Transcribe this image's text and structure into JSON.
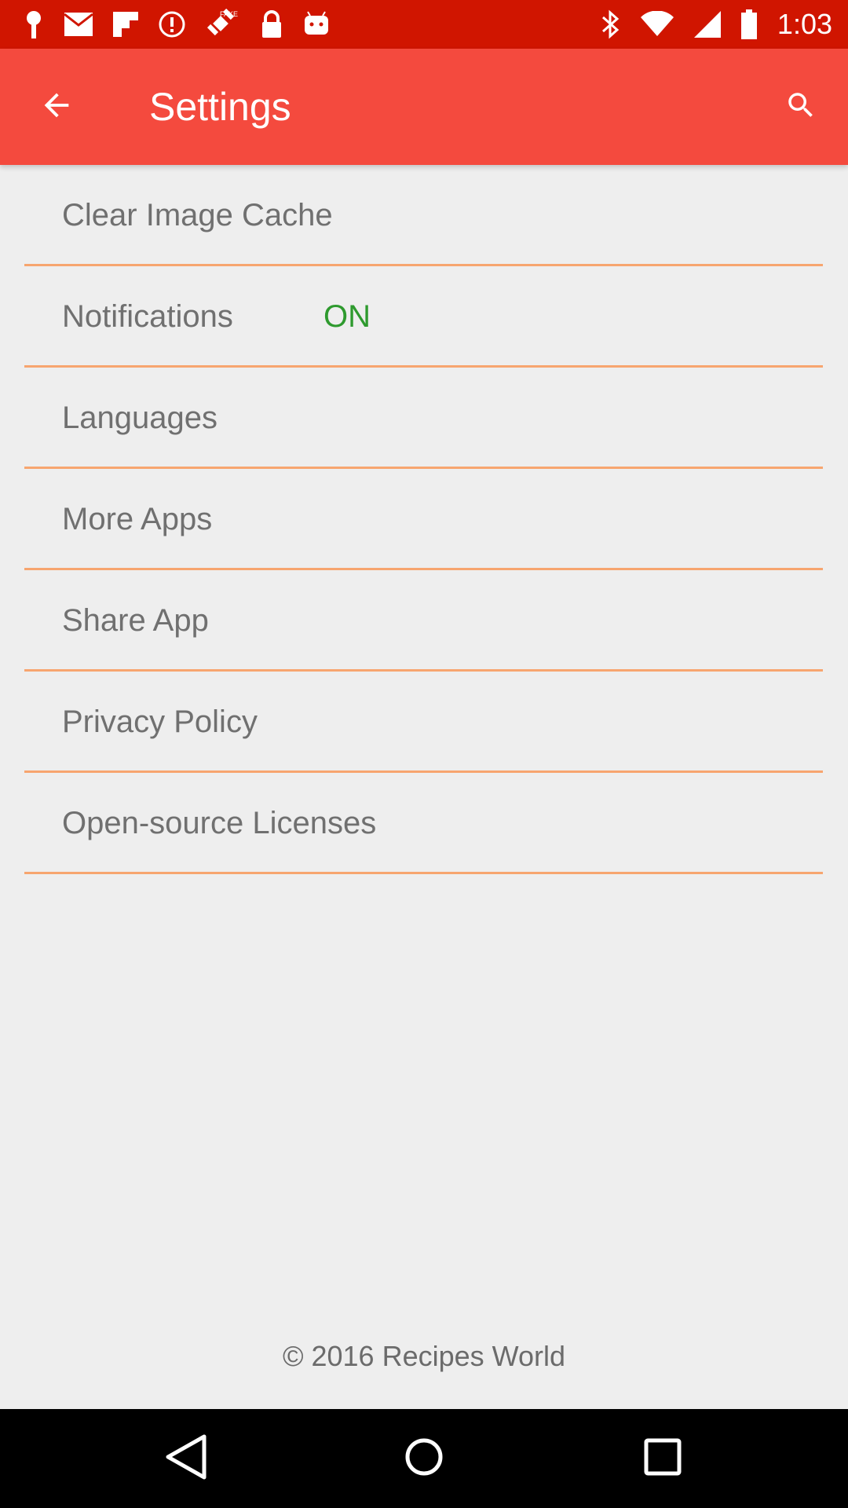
{
  "status_bar": {
    "time": "1:03",
    "left_icons": [
      "pin-icon",
      "mail-icon",
      "flipboard-icon",
      "alert-icon",
      "fake-gps-icon",
      "lock-icon",
      "android-icon"
    ],
    "right_icons": [
      "bluetooth-icon",
      "wifi-icon",
      "signal-icon",
      "battery-icon"
    ],
    "background": "#d01500"
  },
  "app_bar": {
    "title": "Settings",
    "background": "#f44a3e",
    "back_icon": "arrow-back-icon",
    "search_icon": "search-icon"
  },
  "settings": {
    "items": [
      {
        "label": "Clear Image Cache"
      },
      {
        "label": "Notifications",
        "value": "ON"
      },
      {
        "label": "Languages"
      },
      {
        "label": "More Apps"
      },
      {
        "label": "Share App"
      },
      {
        "label": "Privacy Policy"
      },
      {
        "label": "Open-source Licenses"
      }
    ],
    "divider_color": "#f7a56f",
    "value_color": "#2e9a2e"
  },
  "footer": {
    "copyright": "© 2016 Recipes World"
  },
  "nav_bar": {
    "buttons": [
      "back-triangle-icon",
      "home-circle-icon",
      "recents-square-icon"
    ]
  }
}
